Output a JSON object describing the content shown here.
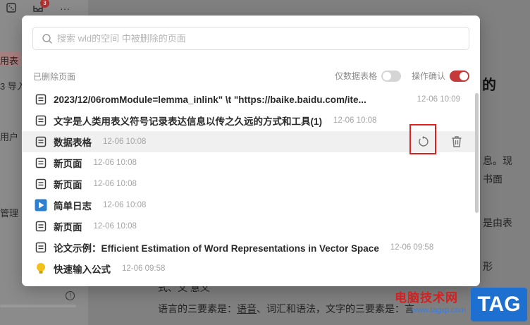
{
  "background": {
    "topbar": {
      "icons": [
        "dice-icon",
        "inbox-icon",
        "more-icon"
      ],
      "inbox_badge": "3",
      "more_glyph": "···"
    },
    "sidebar_fragments": [
      "用表",
      "3 导入",
      "用户",
      "管理"
    ],
    "main_fragments": [
      "的",
      "息。现",
      "书面",
      "是由表",
      "形",
      "式、文 意义"
    ],
    "bottom_text": {
      "prefix": "语言的三要素是：",
      "link": "语音",
      "rest": "、词汇和语法，文字的三要素是：言"
    }
  },
  "modal": {
    "search": {
      "placeholder": "搜索 wld的空间 中被删除的页面",
      "value": ""
    },
    "section_title": "已删除页面",
    "toggles": [
      {
        "label": "仅数据表格",
        "state": "off"
      },
      {
        "label": "操作确认",
        "state": "on"
      }
    ],
    "rows": [
      {
        "icon": "page-icon",
        "title": "2023/12/06romModule=lemma_inlink\" \\t \"https://baike.baidu.com/ite...",
        "date": "12-06 10:09",
        "date_right": true
      },
      {
        "icon": "page-icon",
        "title": "文字是人类用表义符号记录表达信息以传之久远的方式和工具(1)",
        "date": "12-06 10:08"
      },
      {
        "icon": "page-icon",
        "title": "数据表格",
        "date": "12-06 10:08",
        "hover": true
      },
      {
        "icon": "page-icon",
        "title": "新页面",
        "date": "12-06 10:08"
      },
      {
        "icon": "page-icon",
        "title": "新页面",
        "date": "12-06 10:08"
      },
      {
        "icon": "play-icon",
        "title": "简单日志",
        "date": "12-06 10:08"
      },
      {
        "icon": "page-icon",
        "title": "新页面",
        "date": "12-06 10:08"
      },
      {
        "icon": "page-icon",
        "title": "论文示例：Efficient Estimation of Word Representations in Vector Space",
        "date": "12-06 09:58"
      },
      {
        "icon": "bulb-icon",
        "title": "快速输入公式",
        "date": "12-06 09:58"
      }
    ],
    "row_actions": [
      "restore-icon",
      "trash-icon"
    ]
  },
  "watermark": {
    "site_name": "电脑技术网",
    "url": "www.tagxp.com",
    "tag": "TAG"
  },
  "colors": {
    "accent": "#c43a3a",
    "highlight_box": "#e02020",
    "play_icon": "#2f7fd0",
    "bulb_icon": "#f2c21b"
  }
}
